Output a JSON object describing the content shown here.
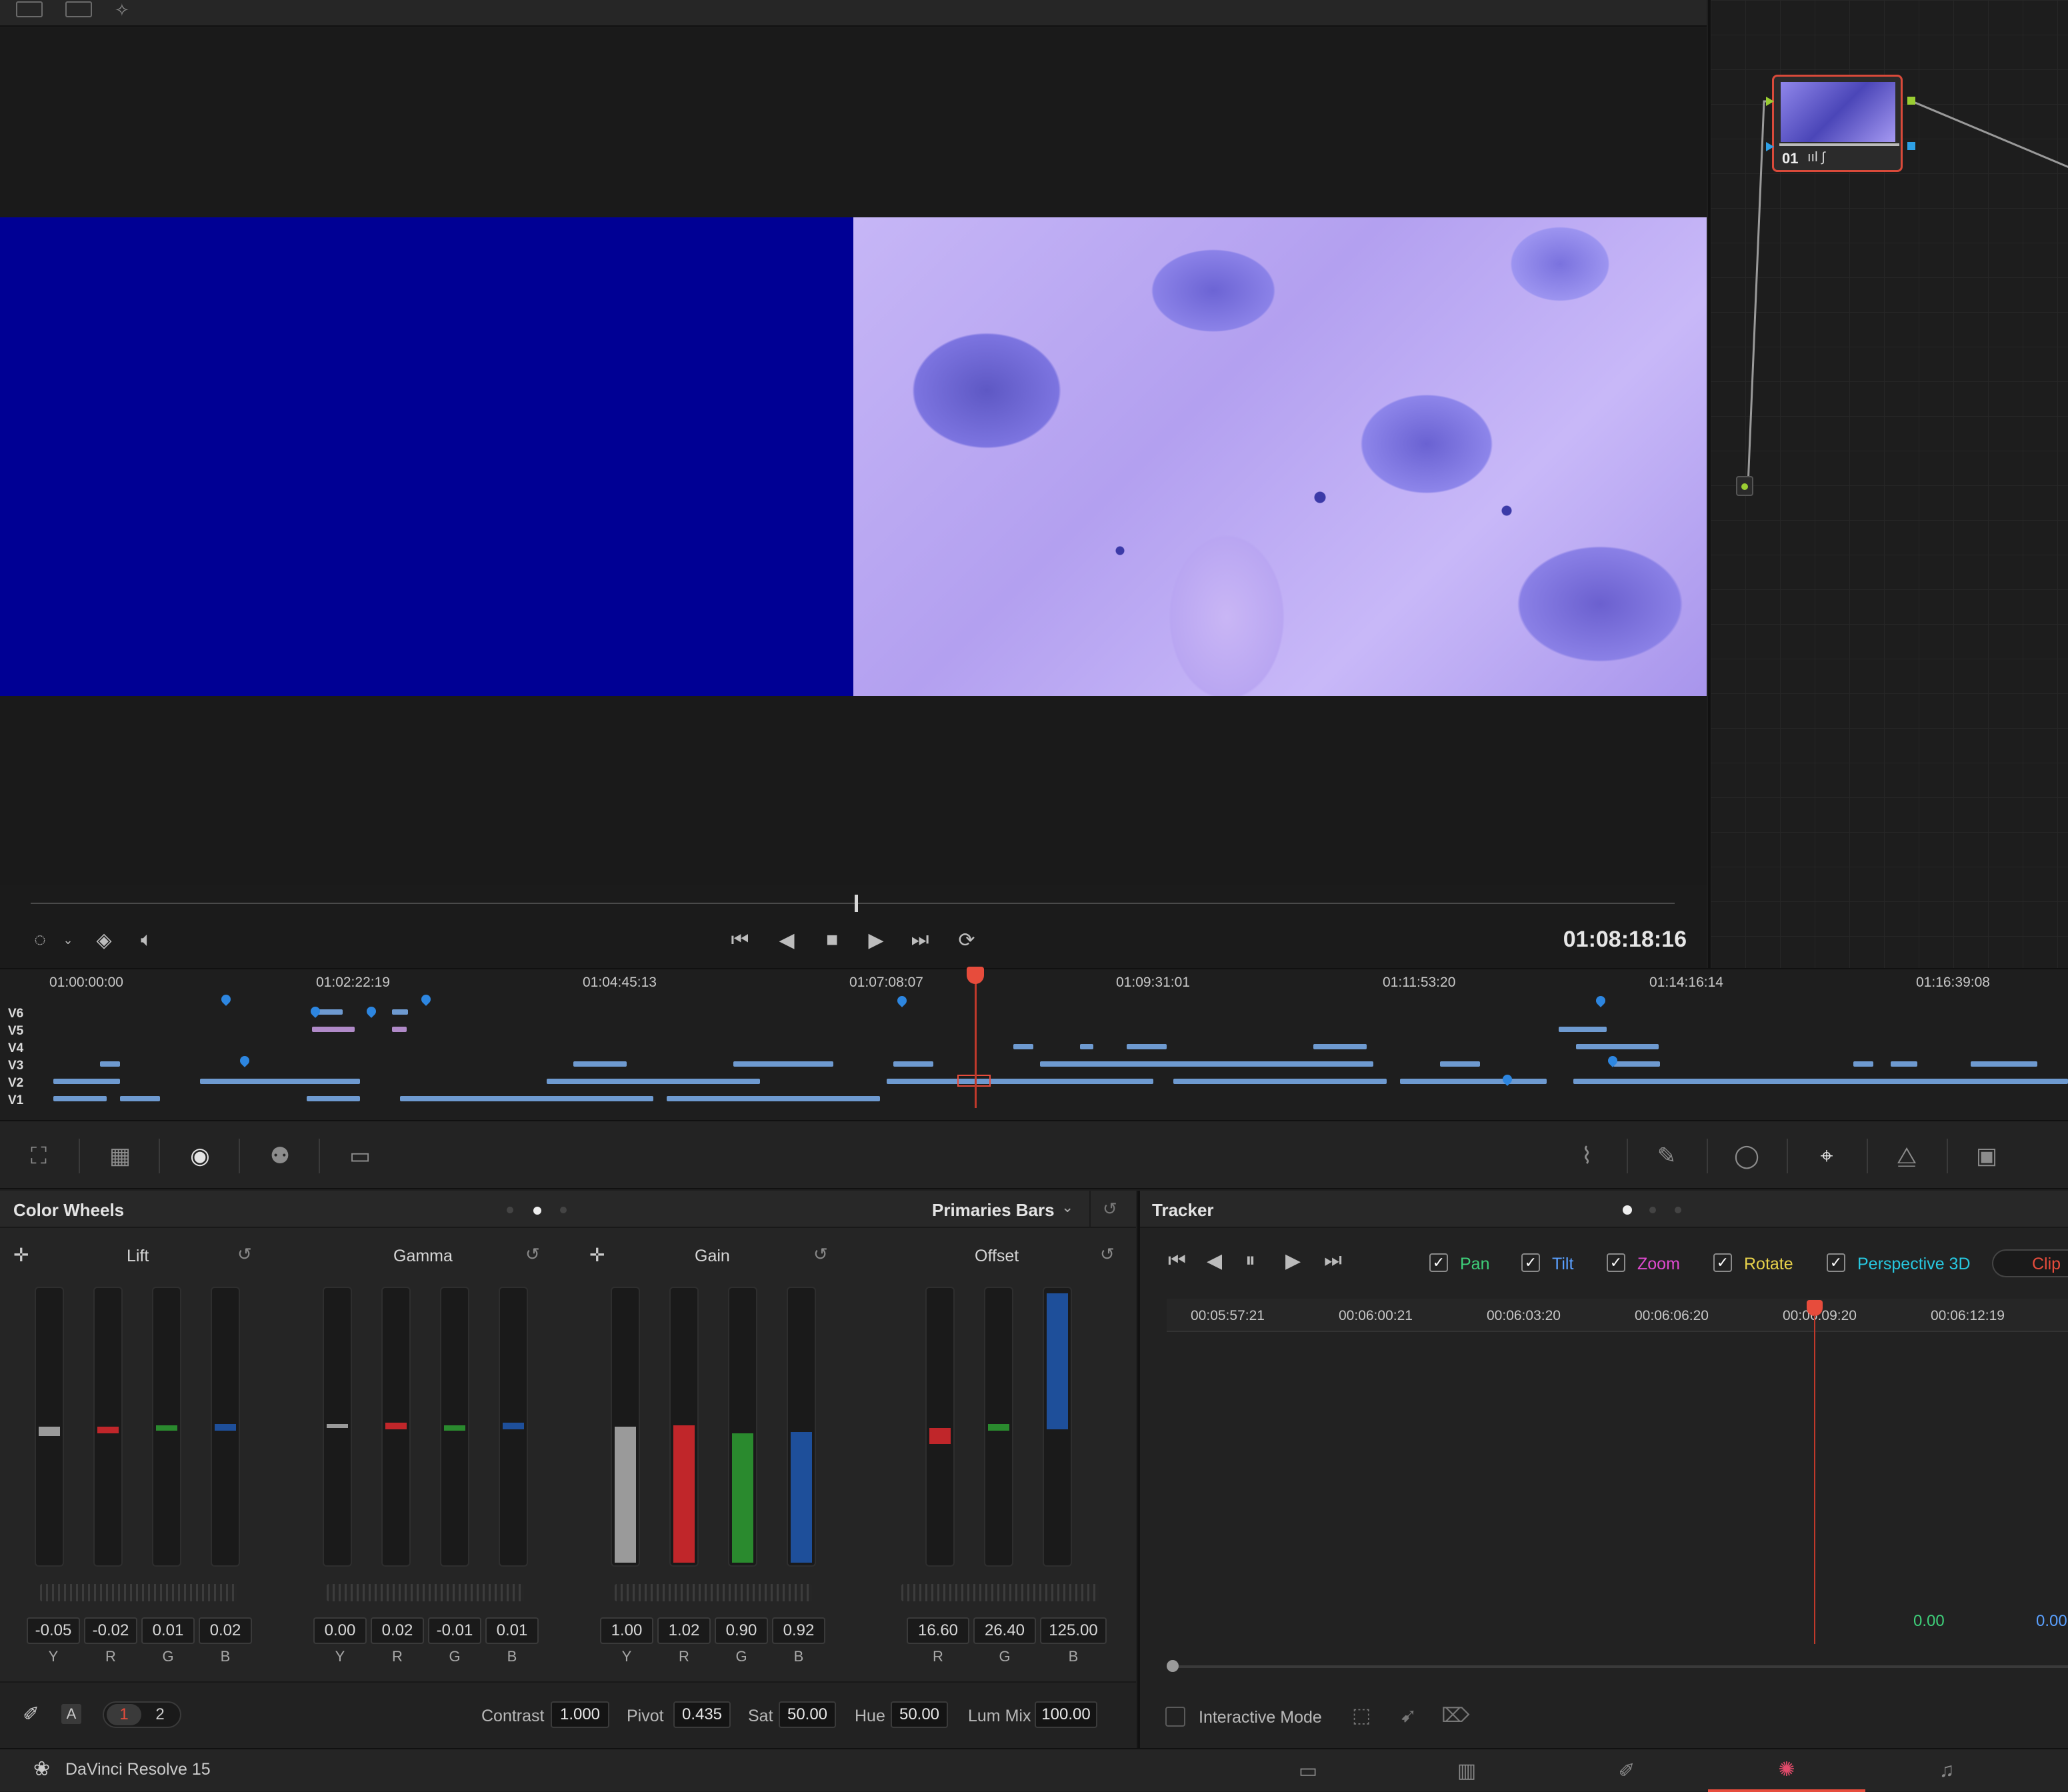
{
  "viewer": {
    "timecode": "01:08:18:16"
  },
  "node": {
    "label": "01"
  },
  "timeline": {
    "ticks": [
      "01:00:00:00",
      "01:02:22:19",
      "01:04:45:13",
      "01:07:08:07",
      "01:09:31:01",
      "01:11:53:20",
      "01:14:16:14",
      "01:16:39:08"
    ],
    "tracks": [
      "V6",
      "V5",
      "V4",
      "V3",
      "V2",
      "V1"
    ]
  },
  "color_wheels": {
    "title": "Color Wheels",
    "mode": "Primaries Bars",
    "groups": [
      {
        "name": "Lift",
        "values": [
          "-0.05",
          "-0.02",
          "0.01",
          "0.02"
        ],
        "channels": [
          "Y",
          "R",
          "G",
          "B"
        ]
      },
      {
        "name": "Gamma",
        "values": [
          "0.00",
          "0.02",
          "-0.01",
          "0.01"
        ],
        "channels": [
          "Y",
          "R",
          "G",
          "B"
        ]
      },
      {
        "name": "Gain",
        "values": [
          "1.00",
          "1.02",
          "0.90",
          "0.92"
        ],
        "channels": [
          "Y",
          "R",
          "G",
          "B"
        ]
      },
      {
        "name": "Offset",
        "values": [
          "16.60",
          "26.40",
          "125.00"
        ],
        "channels": [
          "R",
          "G",
          "B"
        ]
      }
    ],
    "footer": {
      "page1": "1",
      "page2": "2",
      "auto": "A",
      "contrast_label": "Contrast",
      "contrast": "1.000",
      "pivot_label": "Pivot",
      "pivot": "0.435",
      "sat_label": "Sat",
      "sat": "50.00",
      "hue_label": "Hue",
      "hue": "50.00",
      "lummix_label": "Lum Mix",
      "lummix": "100.00"
    }
  },
  "tracker": {
    "title": "Tracker",
    "options": [
      {
        "label": "Pan",
        "color": "#3ed07a"
      },
      {
        "label": "Tilt",
        "color": "#5aa0ff"
      },
      {
        "label": "Zoom",
        "color": "#e04ad0"
      },
      {
        "label": "Rotate",
        "color": "#e8d24a"
      },
      {
        "label": "Perspective 3D",
        "color": "#27c8e0"
      }
    ],
    "clip_label": "Clip",
    "ticks": [
      "00:05:57:21",
      "00:06:00:21",
      "00:06:03:20",
      "00:06:06:20",
      "00:06:09:20",
      "00:06:12:19"
    ],
    "value1": "0.00",
    "value2": "0.00",
    "interactive_mode": "Interactive Mode"
  },
  "footer": {
    "app_name": "DaVinci Resolve 15"
  },
  "colors": {
    "accent_red": "#e74c3c",
    "bar_y": "#9a9a9a",
    "bar_r": "#c0262a",
    "bar_g": "#2a8a2e",
    "bar_b": "#1e4f9a"
  }
}
